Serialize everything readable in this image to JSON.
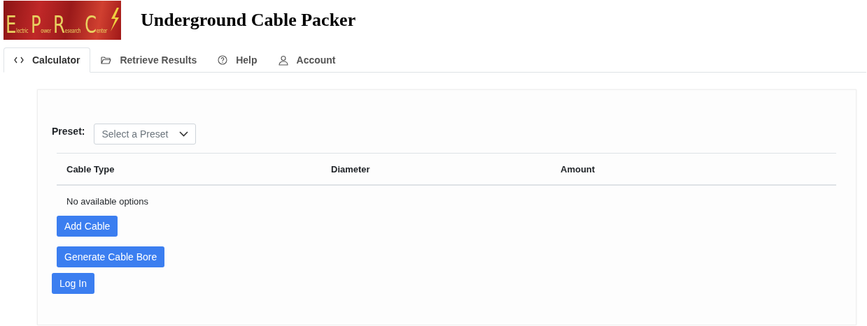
{
  "header": {
    "logo": {
      "words": [
        "Electric",
        "Power",
        "Research",
        "Center"
      ]
    },
    "title": "Underground Cable Packer"
  },
  "tabs": [
    {
      "label": "Calculator",
      "kind": "code",
      "selected": true
    },
    {
      "label": "Retrieve Results",
      "kind": "folder",
      "selected": false
    },
    {
      "label": "Help",
      "kind": "help",
      "selected": false
    },
    {
      "label": "Account",
      "kind": "user",
      "selected": false
    }
  ],
  "preset": {
    "label": "Preset:",
    "placeholder": "Select a Preset"
  },
  "table": {
    "columns": [
      "Cable Type",
      "Diameter",
      "Amount"
    ],
    "empty_message": "No available options"
  },
  "buttons": [
    {
      "label": "Add Cable",
      "kind": "indented"
    },
    {
      "label": "Generate Cable Bore",
      "kind": "indented"
    },
    {
      "label": "Log In",
      "kind": "flush"
    }
  ]
}
